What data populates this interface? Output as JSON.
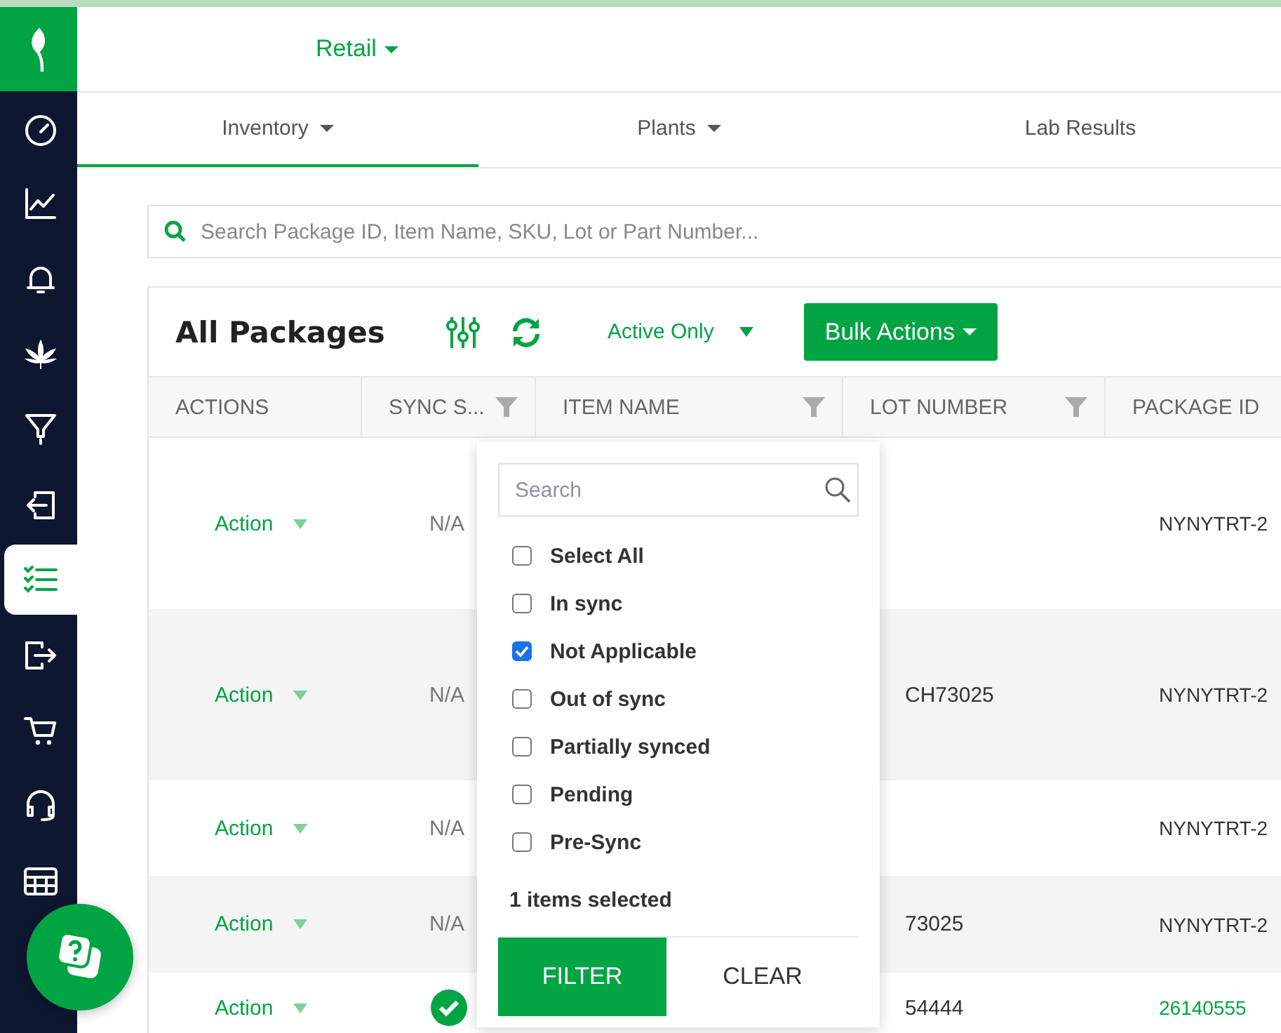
{
  "header": {
    "location": "Retail"
  },
  "sidebar": {
    "items": [
      {
        "kind": "gauge",
        "selected": false
      },
      {
        "kind": "chart",
        "selected": false
      },
      {
        "kind": "bell",
        "selected": false
      },
      {
        "kind": "leaf",
        "selected": false
      },
      {
        "kind": "funnel",
        "selected": false
      },
      {
        "kind": "signin",
        "selected": false
      },
      {
        "kind": "checklist",
        "selected": true
      },
      {
        "kind": "signout",
        "selected": false
      },
      {
        "kind": "cart",
        "selected": false
      },
      {
        "kind": "headset",
        "selected": false
      },
      {
        "kind": "table",
        "selected": false
      }
    ]
  },
  "tabs": [
    {
      "label": "Inventory",
      "dropdown": true,
      "selected": true
    },
    {
      "label": "Plants",
      "dropdown": true,
      "selected": false
    },
    {
      "label": "Lab Results",
      "dropdown": false,
      "selected": false
    }
  ],
  "search": {
    "placeholder": "Search Package ID, Item Name, SKU, Lot or Part Number..."
  },
  "packages": {
    "title": "All Packages",
    "status_filter": "Active Only",
    "bulk_button": "Bulk Actions",
    "columns": [
      {
        "label": "ACTIONS",
        "filter": false
      },
      {
        "label": "SYNC S...",
        "filter": true
      },
      {
        "label": "ITEM NAME",
        "filter": true
      },
      {
        "label": "LOT NUMBER",
        "filter": true
      },
      {
        "label": "PACKAGE ID",
        "filter": false
      }
    ],
    "rows": [
      {
        "action": "Action",
        "sync": {
          "kind": "text",
          "text": "N/A"
        },
        "lot": "",
        "package_id": "NYNYTRT-2",
        "link": false
      },
      {
        "action": "Action",
        "sync": {
          "kind": "text",
          "text": "N/A"
        },
        "lot": "CH73025",
        "package_id": "NYNYTRT-2",
        "link": false
      },
      {
        "action": "Action",
        "sync": {
          "kind": "text",
          "text": "N/A"
        },
        "lot": "",
        "package_id": "NYNYTRT-2",
        "link": false
      },
      {
        "action": "Action",
        "sync": {
          "kind": "text",
          "text": "N/A"
        },
        "lot": "73025",
        "package_id": "NYNYTRT-2",
        "link": false
      },
      {
        "action": "Action",
        "sync": {
          "kind": "check"
        },
        "lot": "54444",
        "package_id": "26140555",
        "link": true
      }
    ]
  },
  "sync_filter_popup": {
    "placeholder": "Search",
    "options": [
      {
        "label": "Select All",
        "checked": false
      },
      {
        "label": "In sync",
        "checked": false
      },
      {
        "label": "Not Applicable",
        "checked": true
      },
      {
        "label": "Out of sync",
        "checked": false
      },
      {
        "label": "Partially synced",
        "checked": false
      },
      {
        "label": "Pending",
        "checked": false
      },
      {
        "label": "Pre-Sync",
        "checked": false
      }
    ],
    "summary": "1 items selected",
    "buttons": [
      {
        "label": "FILTER",
        "primary": true
      },
      {
        "label": "CLEAR",
        "primary": false
      }
    ]
  }
}
